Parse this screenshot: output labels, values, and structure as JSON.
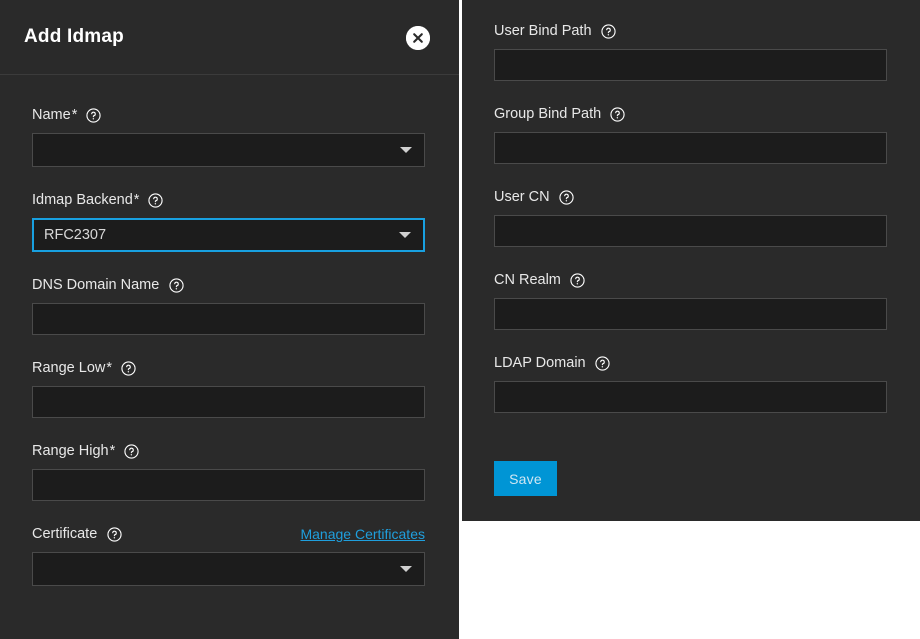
{
  "dialog": {
    "title": "Add Idmap",
    "close_icon": "close-circle-icon"
  },
  "icons": {
    "help": "help-circle-icon",
    "dropdown": "chevron-down-icon"
  },
  "left_column": {
    "fields": [
      {
        "label": "Name",
        "required": "*",
        "type": "select",
        "value": "",
        "focused": false
      },
      {
        "label": "Idmap Backend",
        "required": "*",
        "type": "select",
        "value": "RFC2307",
        "focused": true
      },
      {
        "label": "DNS Domain Name",
        "required": "",
        "type": "text",
        "value": "",
        "placeholder": ""
      },
      {
        "label": "Range Low",
        "required": "*",
        "type": "text",
        "value": "",
        "placeholder": ""
      },
      {
        "label": "Range High",
        "required": "*",
        "type": "text",
        "value": "",
        "placeholder": ""
      },
      {
        "label": "Certificate",
        "required": "",
        "type": "select",
        "value": "",
        "focused": false,
        "action_link": "Manage Certificates"
      }
    ]
  },
  "right_column": {
    "fields": [
      {
        "label": "User Bind Path",
        "required": "",
        "type": "text",
        "value": "",
        "placeholder": ""
      },
      {
        "label": "Group Bind Path",
        "required": "",
        "type": "text",
        "value": "",
        "placeholder": ""
      },
      {
        "label": "User CN",
        "required": "",
        "type": "text",
        "value": "",
        "placeholder": ""
      },
      {
        "label": "CN Realm",
        "required": "",
        "type": "text",
        "value": "",
        "placeholder": ""
      },
      {
        "label": "LDAP Domain",
        "required": "",
        "type": "text",
        "value": "",
        "placeholder": ""
      }
    ],
    "save_label": "Save"
  },
  "colors": {
    "panel_bg": "#2a2a2a",
    "input_bg": "#1c1c1c",
    "accent": "#0095d5",
    "focus_border": "#18a0e0",
    "link": "#1f9fdd"
  }
}
